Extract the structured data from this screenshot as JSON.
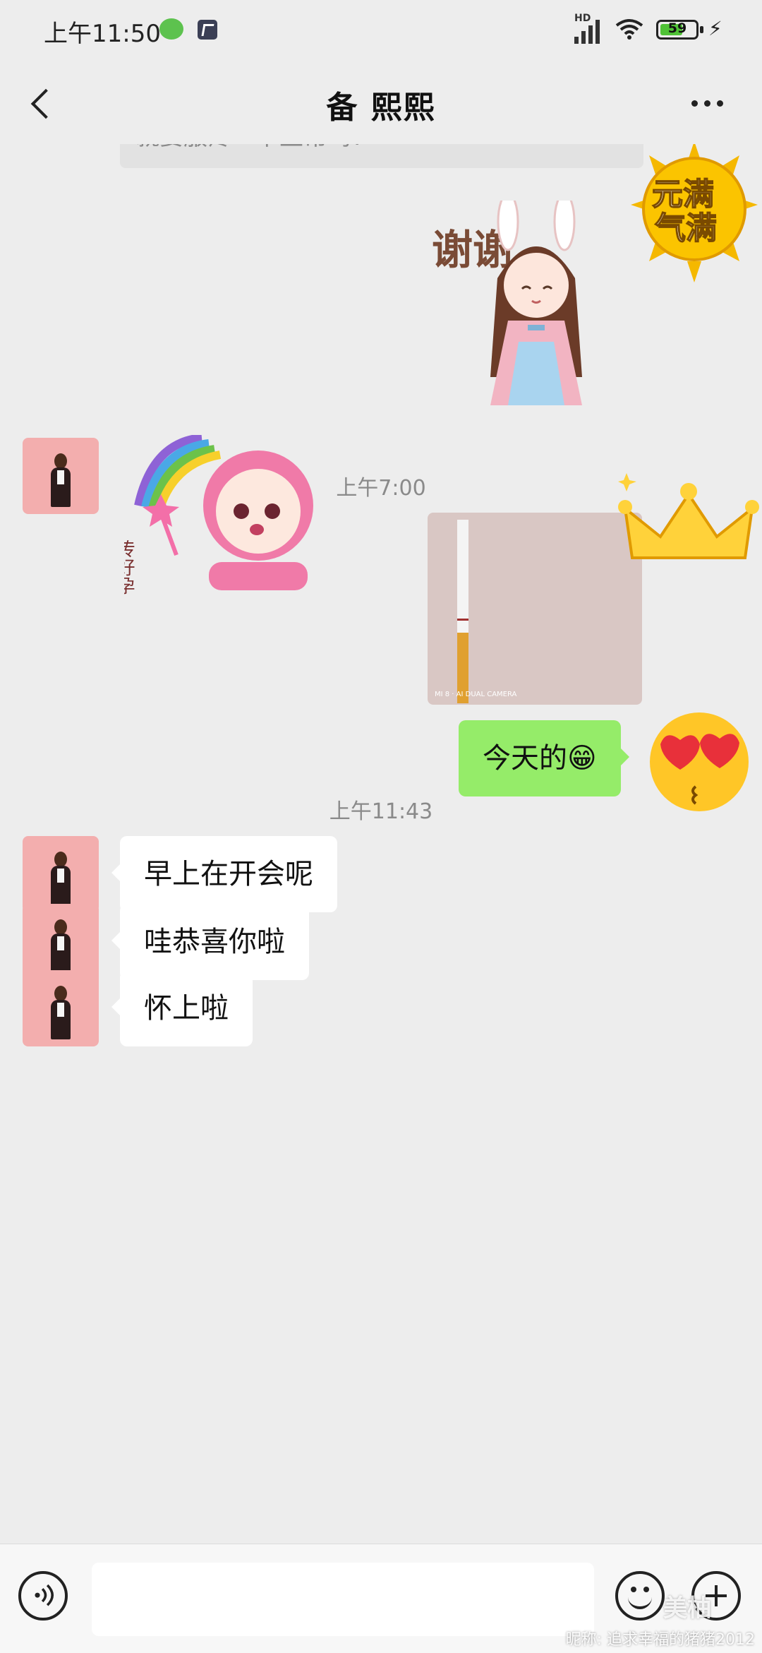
{
  "status_bar": {
    "time": "上午11:50",
    "battery": "59",
    "network": "HD"
  },
  "nav": {
    "title": "备 熙熙"
  },
  "chat": {
    "cut_off_text": "就要服疼一下正常吗?",
    "stickers": {
      "thanks": "谢谢",
      "sun_badge_top": "元满",
      "sun_badge_bottom": "气满",
      "baby_caption": "传好孕"
    },
    "time_1": "上午7:00",
    "photo_watermark": "MI 8 · AI DUAL CAMERA",
    "outgoing_text": "今天的😁",
    "time_2": "上午11:43",
    "incoming": [
      {
        "text": "早上在开会呢"
      },
      {
        "text": "哇恭喜你啦"
      },
      {
        "text": "怀上啦"
      }
    ]
  },
  "input": {
    "placeholder": ""
  },
  "watermark": {
    "logo": "美柚",
    "nickname": "昵称: 追求幸福的猪猪2012"
  },
  "colors": {
    "background": "#ededed",
    "outgoing_bubble": "#95ec69",
    "incoming_bubble": "#ffffff"
  }
}
